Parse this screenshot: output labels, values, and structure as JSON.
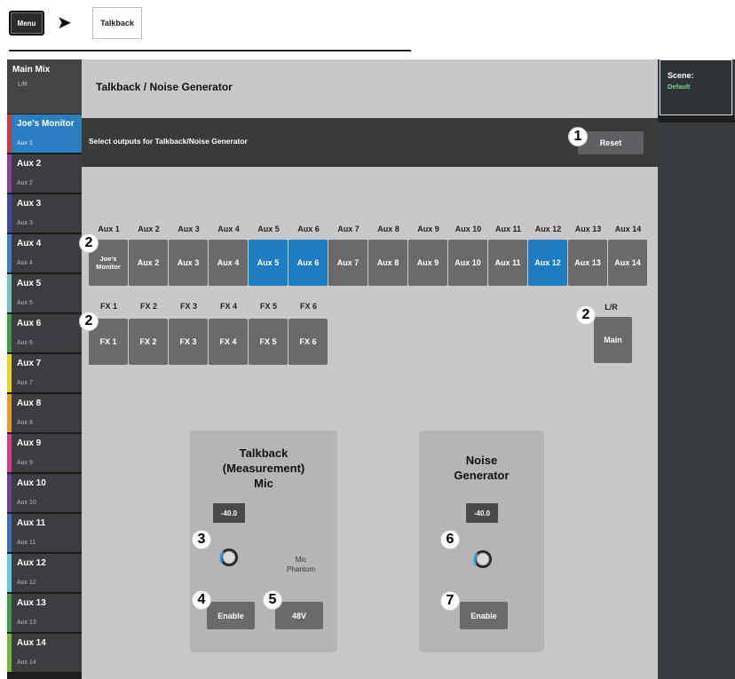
{
  "breadcrumb": {
    "menu": "Menu",
    "current": "Talkback"
  },
  "main_mix": {
    "title": "Main Mix",
    "sub": "L/R"
  },
  "sidebar": [
    {
      "name": "Joe's Monitor",
      "sub": "Aux 1",
      "color": "#d23a3a",
      "active": true
    },
    {
      "name": "Aux 2",
      "sub": "Aux 2",
      "color": "#8b3fa0"
    },
    {
      "name": "Aux 3",
      "sub": "Aux 3",
      "color": "#3b4aa8"
    },
    {
      "name": "Aux 4",
      "sub": "Aux 4",
      "color": "#3a7fc1"
    },
    {
      "name": "Aux 5",
      "sub": "Aux 5",
      "color": "#6cc7b8"
    },
    {
      "name": "Aux 6",
      "sub": "Aux 6",
      "color": "#3aa04a"
    },
    {
      "name": "Aux 7",
      "sub": "Aux 7",
      "color": "#e8d22a"
    },
    {
      "name": "Aux 8",
      "sub": "Aux 8",
      "color": "#e89a2a"
    },
    {
      "name": "Aux 9",
      "sub": "Aux 9",
      "color": "#d83f8a"
    },
    {
      "name": "Aux 10",
      "sub": "Aux 10",
      "color": "#6a3f9a"
    },
    {
      "name": "Aux 11",
      "sub": "Aux 11",
      "color": "#3a6fc0"
    },
    {
      "name": "Aux 12",
      "sub": "Aux 12",
      "color": "#5fc7e0"
    },
    {
      "name": "Aux 13",
      "sub": "Aux 13",
      "color": "#3aa04a"
    },
    {
      "name": "Aux 14",
      "sub": "Aux 14",
      "color": "#7ab83a"
    }
  ],
  "page_title": "Talkback / Noise Generator",
  "select_text": "Select outputs for Talkback/Noise Generator",
  "reset_label": "Reset",
  "aux_outputs": [
    {
      "label": "Aux 1",
      "button": "Joe's\nMonitor",
      "selected": false
    },
    {
      "label": "Aux 2",
      "button": "Aux 2",
      "selected": false
    },
    {
      "label": "Aux 3",
      "button": "Aux 3",
      "selected": false
    },
    {
      "label": "Aux 4",
      "button": "Aux 4",
      "selected": false
    },
    {
      "label": "Aux 5",
      "button": "Aux 5",
      "selected": true
    },
    {
      "label": "Aux 6",
      "button": "Aux 6",
      "selected": true
    },
    {
      "label": "Aux 7",
      "button": "Aux 7",
      "selected": false
    },
    {
      "label": "Aux 8",
      "button": "Aux 8",
      "selected": false
    },
    {
      "label": "Aux 9",
      "button": "Aux 9",
      "selected": false
    },
    {
      "label": "Aux 10",
      "button": "Aux 10",
      "selected": false
    },
    {
      "label": "Aux 11",
      "button": "Aux 11",
      "selected": false
    },
    {
      "label": "Aux 12",
      "button": "Aux 12",
      "selected": true
    },
    {
      "label": "Aux 13",
      "button": "Aux 13",
      "selected": false
    },
    {
      "label": "Aux 14",
      "button": "Aux 14",
      "selected": false
    }
  ],
  "fx_outputs": [
    {
      "label": "FX 1",
      "button": "FX 1"
    },
    {
      "label": "FX 2",
      "button": "FX 2"
    },
    {
      "label": "FX 3",
      "button": "FX 3"
    },
    {
      "label": "FX 4",
      "button": "FX 4"
    },
    {
      "label": "FX 5",
      "button": "FX 5"
    },
    {
      "label": "FX 6",
      "button": "FX 6"
    }
  ],
  "lr": {
    "label": "L/R",
    "button": "Main"
  },
  "talkback": {
    "title_lines": [
      "Talkback",
      "(Measurement)",
      "Mic"
    ],
    "level": "-40.0",
    "phantom_lines": [
      "Mic",
      "Phantom"
    ],
    "enable_label": "Enable",
    "phantom_label": "48V"
  },
  "noise": {
    "title_lines": [
      "Noise",
      "Generator"
    ],
    "level": "-40.0",
    "enable_label": "Enable"
  },
  "callouts": {
    "reset": "1",
    "aux": "2",
    "fx": "2",
    "lr": "2",
    "talk_knob": "3",
    "talk_enable": "4",
    "phantom": "5",
    "noise_knob": "6",
    "noise_enable": "7"
  },
  "scene": {
    "title": "Scene:",
    "value": "Default"
  }
}
